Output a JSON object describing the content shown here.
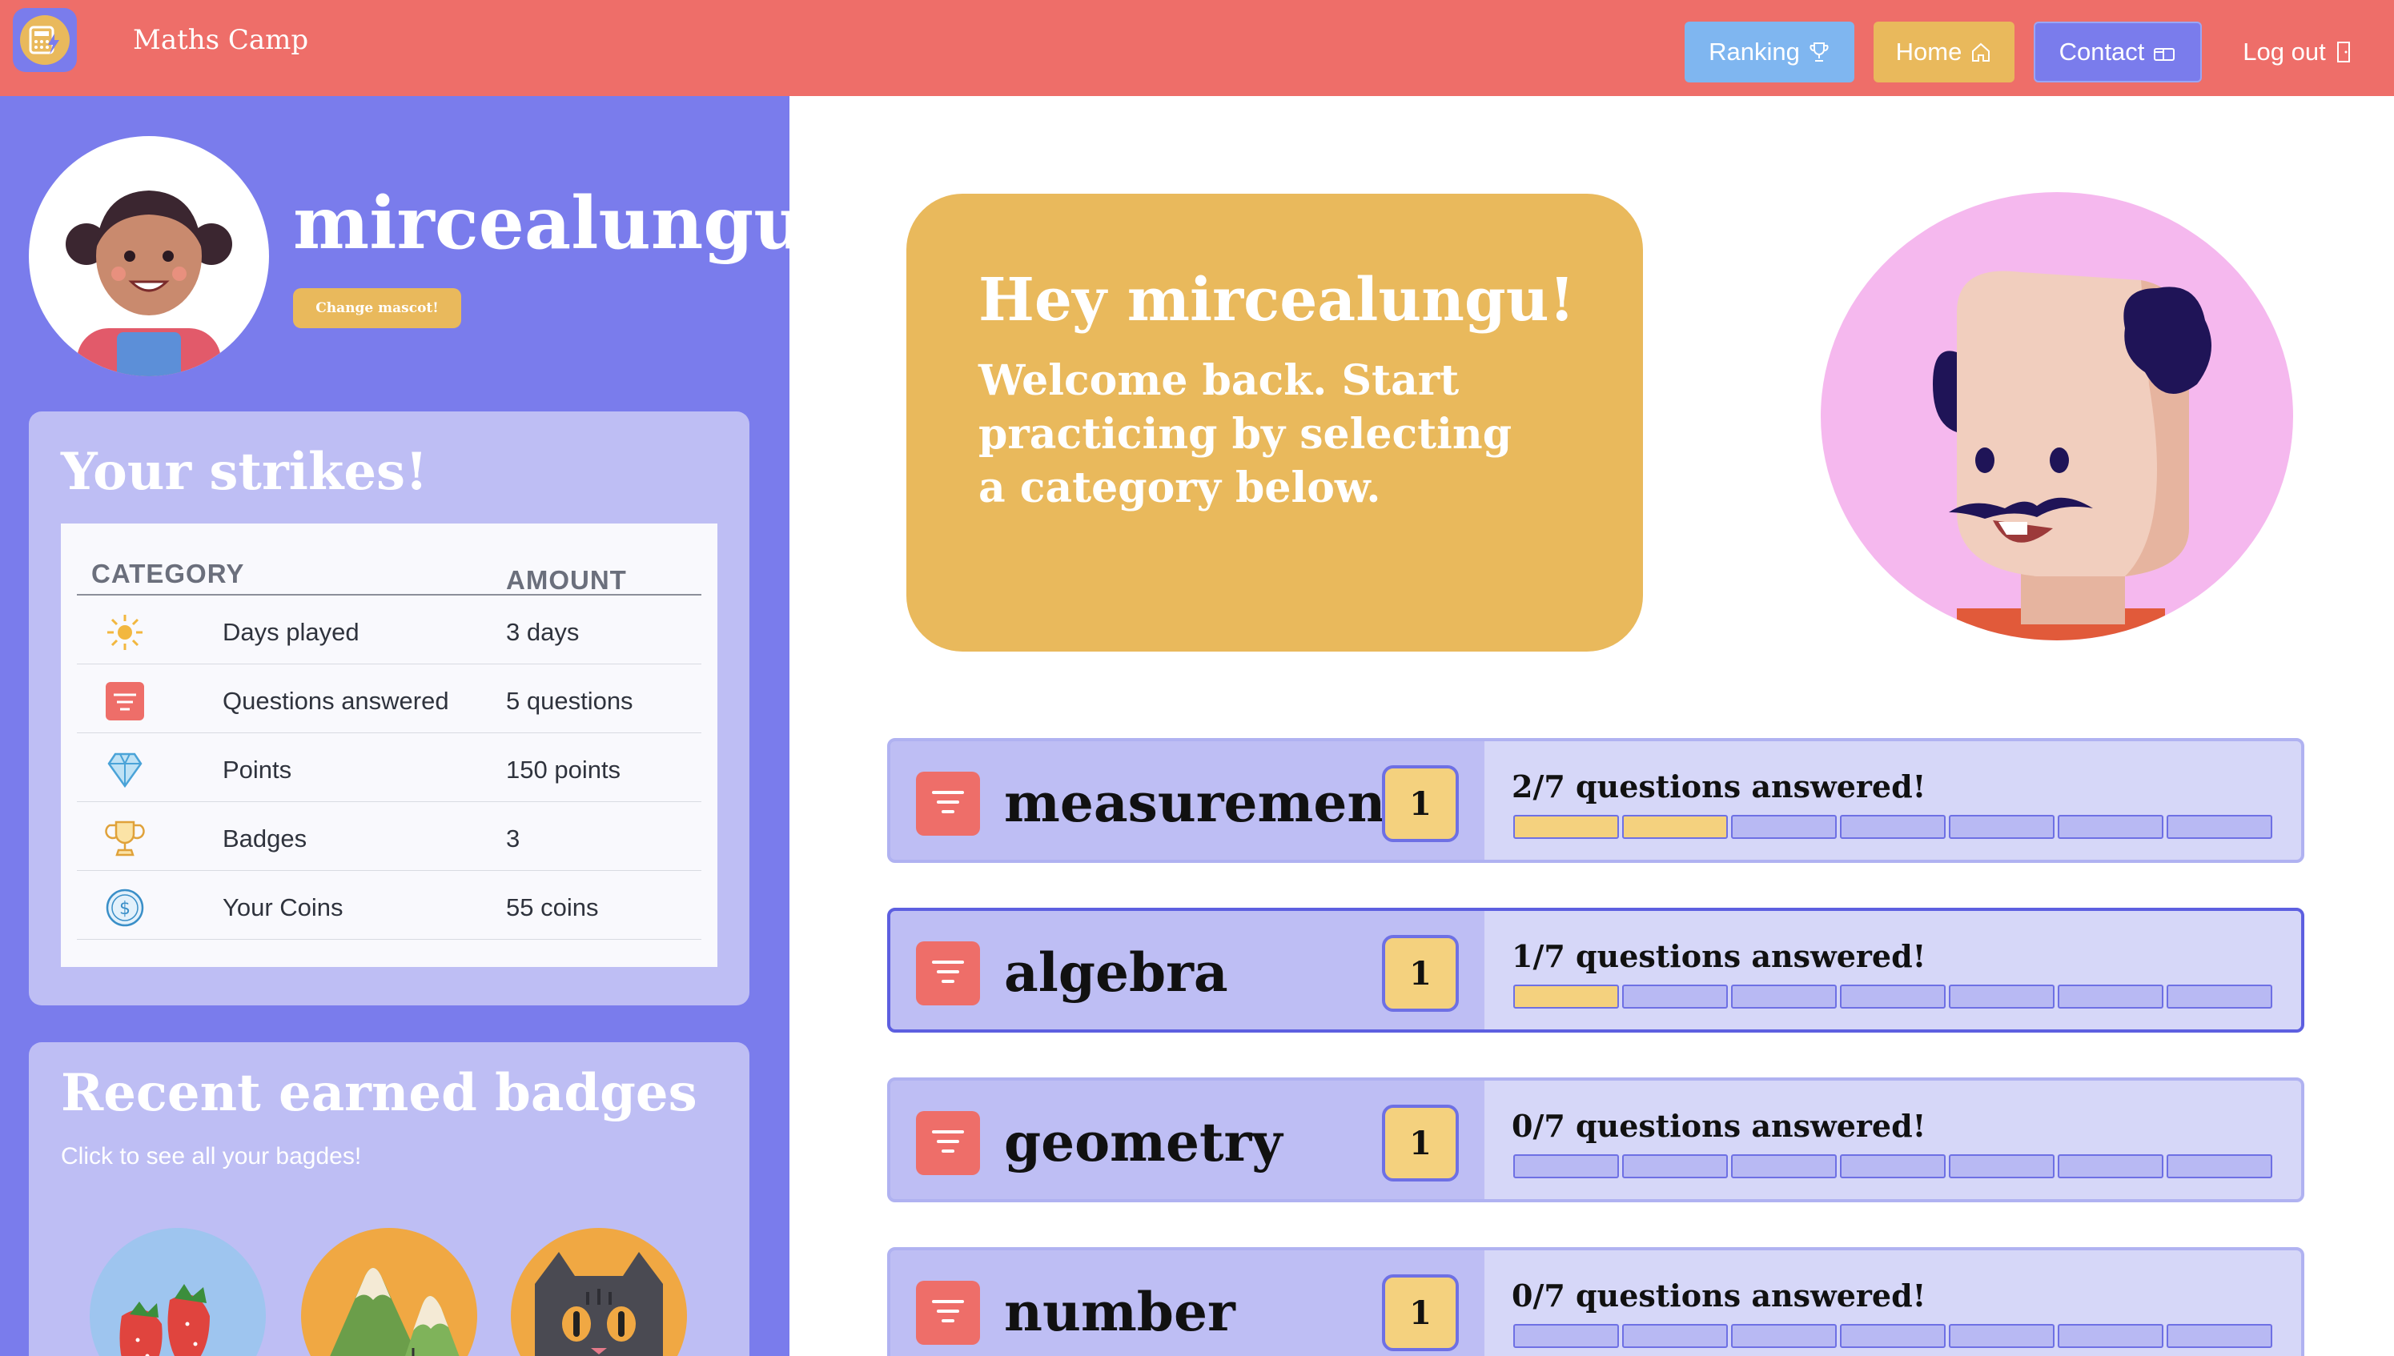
{
  "app": {
    "title": "Maths Camp"
  },
  "nav": {
    "ranking": "Ranking",
    "home": "Home",
    "contact": "Contact",
    "logout": "Log out"
  },
  "profile": {
    "username": "mircealungu",
    "change_mascot": "Change mascot!"
  },
  "strikes": {
    "title": "Your strikes!",
    "columns": [
      "CATEGORY",
      "AMOUNT"
    ],
    "rows": [
      {
        "icon": "sun-icon",
        "label": "Days played",
        "value": "3 days"
      },
      {
        "icon": "questions-icon",
        "label": "Questions answered",
        "value": "5 questions"
      },
      {
        "icon": "diamond-icon",
        "label": "Points",
        "value": "150 points"
      },
      {
        "icon": "trophy-icon",
        "label": "Badges",
        "value": "3"
      },
      {
        "icon": "coin-icon",
        "label": "Your Coins",
        "value": "55 coins"
      }
    ]
  },
  "badges": {
    "title": "Recent earned badges",
    "subtitle": "Click to see all your bagdes!",
    "items": [
      "strawberry-badge",
      "mountain-badge",
      "cat-badge"
    ]
  },
  "welcome": {
    "title": "Hey mircealungu!",
    "text": "Welcome back. Start practicing by selecting a category below."
  },
  "categories": [
    {
      "name": "measurement",
      "level": "1",
      "progress_text": "2/7 questions answered!",
      "answered": 2,
      "total": 7,
      "active": false
    },
    {
      "name": "algebra",
      "level": "1",
      "progress_text": "1/7 questions answered!",
      "answered": 1,
      "total": 7,
      "active": true
    },
    {
      "name": "geometry",
      "level": "1",
      "progress_text": "0/7 questions answered!",
      "answered": 0,
      "total": 7,
      "active": false
    },
    {
      "name": "number",
      "level": "1",
      "progress_text": "0/7 questions answered!",
      "answered": 0,
      "total": 7,
      "active": false
    }
  ],
  "colors": {
    "nav_bar": "#ee6e69",
    "sidebar": "#7a7cec",
    "card": "#bebef4",
    "accent_yellow": "#e9b95c",
    "progress_done": "#f4d17e"
  }
}
